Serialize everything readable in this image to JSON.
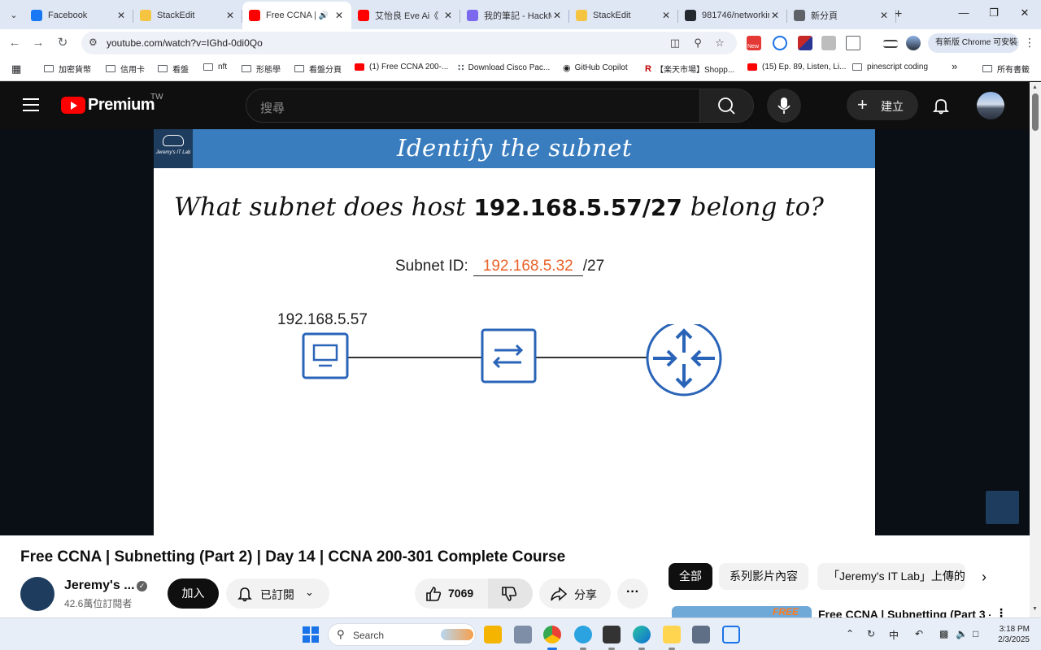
{
  "browser": {
    "tabs": [
      {
        "title": "Facebook",
        "favicon_color": "#1877f2",
        "active": false
      },
      {
        "title": "StackEdit",
        "favicon_color": "#f5c542",
        "active": false
      },
      {
        "title": "Free CCNA |",
        "favicon_color": "#ff0000",
        "active": true,
        "audio": true
      },
      {
        "title": "艾怡良 Eve Ai《",
        "favicon_color": "#ff0000",
        "active": false
      },
      {
        "title": "我的筆記 - HackM",
        "favicon_color": "#7b68ee",
        "active": false
      },
      {
        "title": "StackEdit",
        "favicon_color": "#f5c542",
        "active": false
      },
      {
        "title": "981746/networkin",
        "favicon_color": "#24292f",
        "active": false
      },
      {
        "title": "新分頁",
        "favicon_color": "#5f6368",
        "active": false
      }
    ],
    "url": "youtube.com/watch?v=IGhd-0di0Qo",
    "update_button": "有新版 Chrome 可安裝",
    "ext_new_badge": "New",
    "bookmarks": [
      {
        "label": "加密貨幣",
        "type": "folder"
      },
      {
        "label": "信用卡",
        "type": "folder"
      },
      {
        "label": "看盤",
        "type": "folder"
      },
      {
        "label": "nft",
        "type": "folder"
      },
      {
        "label": "形態學",
        "type": "folder"
      },
      {
        "label": "看盤分頁",
        "type": "folder"
      },
      {
        "label": "(1) Free CCNA 200-...",
        "type": "youtube"
      },
      {
        "label": "Download Cisco Pac...",
        "type": "cisco"
      },
      {
        "label": "GitHub Copilot",
        "type": "github"
      },
      {
        "label": "【楽天市場】Shopp...",
        "type": "rakuten"
      },
      {
        "label": "(15) Ep. 89, Listen, Li...",
        "type": "youtube"
      },
      {
        "label": "pinescript coding",
        "type": "folder"
      }
    ],
    "bookmarks_overflow": "»",
    "all_bookmarks": "所有書籤"
  },
  "youtube": {
    "logo_text": "Premium",
    "region": "TW",
    "search_placeholder": "搜尋",
    "create_label": "建立"
  },
  "slide": {
    "logo_name": "Jeremy's IT Lab",
    "header_title": "Identify the subnet",
    "question_prefix": "What subnet does host",
    "question_ip": "192.168.5.57/27",
    "question_suffix": "belong to?",
    "subnet_label": "Subnet ID:",
    "subnet_answer": "192.168.5.32",
    "subnet_mask": "/27",
    "host_ip": "192.168.5.57",
    "accent_color": "#3a7dbf",
    "answer_color": "#e8622a",
    "device_color": "#2a64b8"
  },
  "video": {
    "title": "Free CCNA | Subnetting (Part 2) | Day 14 | CCNA 200-301 Complete Course",
    "channel_name": "Jeremy's ...",
    "subscribers": "42.6萬位訂閱者",
    "join_label": "加入",
    "subscribed_label": "已訂閱",
    "like_count": "7069",
    "share_label": "分享"
  },
  "sidebar": {
    "chips": [
      "全部",
      "系列影片內容",
      "「Jeremy's IT Lab」上傳的"
    ],
    "rec_title": "Free CCNA | Subnetting (Part 3 -",
    "rec_thumb_tag": "FREE"
  },
  "taskbar": {
    "search_label": "Search",
    "ime_label": "中",
    "time": "3:18 PM",
    "date": "2/3/2025"
  }
}
